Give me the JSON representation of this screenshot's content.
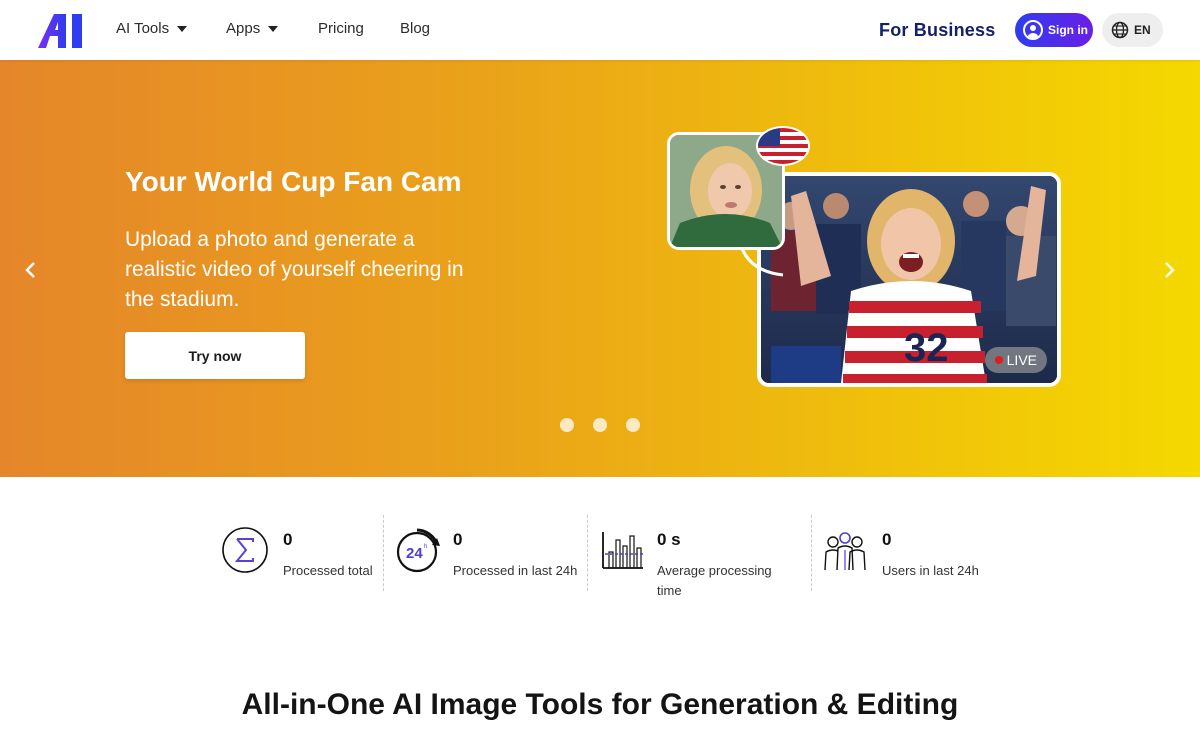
{
  "nav": {
    "items": [
      {
        "label": "AI Tools",
        "has_dropdown": true
      },
      {
        "label": "Apps",
        "has_dropdown": true
      },
      {
        "label": "Pricing",
        "has_dropdown": false
      },
      {
        "label": "Blog",
        "has_dropdown": false
      }
    ],
    "business_label": "For Business",
    "signin_label": "Sign in",
    "lang_label": "EN"
  },
  "hero": {
    "title": "Your World Cup Fan Cam",
    "subtitle": "Upload a photo and generate a realistic video of yourself cheering in the stadium.",
    "cta_label": "Try now",
    "live_label": "LIVE",
    "jersey_number": "32",
    "slides_count": 3
  },
  "stats": [
    {
      "value": "0",
      "label": "Processed total",
      "icon": "sigma-icon"
    },
    {
      "value": "0",
      "label": "Processed in last 24h",
      "icon": "24h-clock-icon"
    },
    {
      "value": "0 s",
      "label": "Average processing time",
      "icon": "bar-chart-icon"
    },
    {
      "value": "0",
      "label": "Users in last 24h",
      "icon": "users-group-icon"
    }
  ],
  "section": {
    "title": "All-in-One AI Image Tools for Generation & Editing"
  },
  "colors": {
    "brand_blue": "#15206a",
    "signin_gradient_start": "#2f3cf0",
    "signin_gradient_end": "#6a1fe6",
    "hero_left": "#e5862a",
    "hero_right": "#f5d800",
    "live_dot": "#e21b1b"
  }
}
